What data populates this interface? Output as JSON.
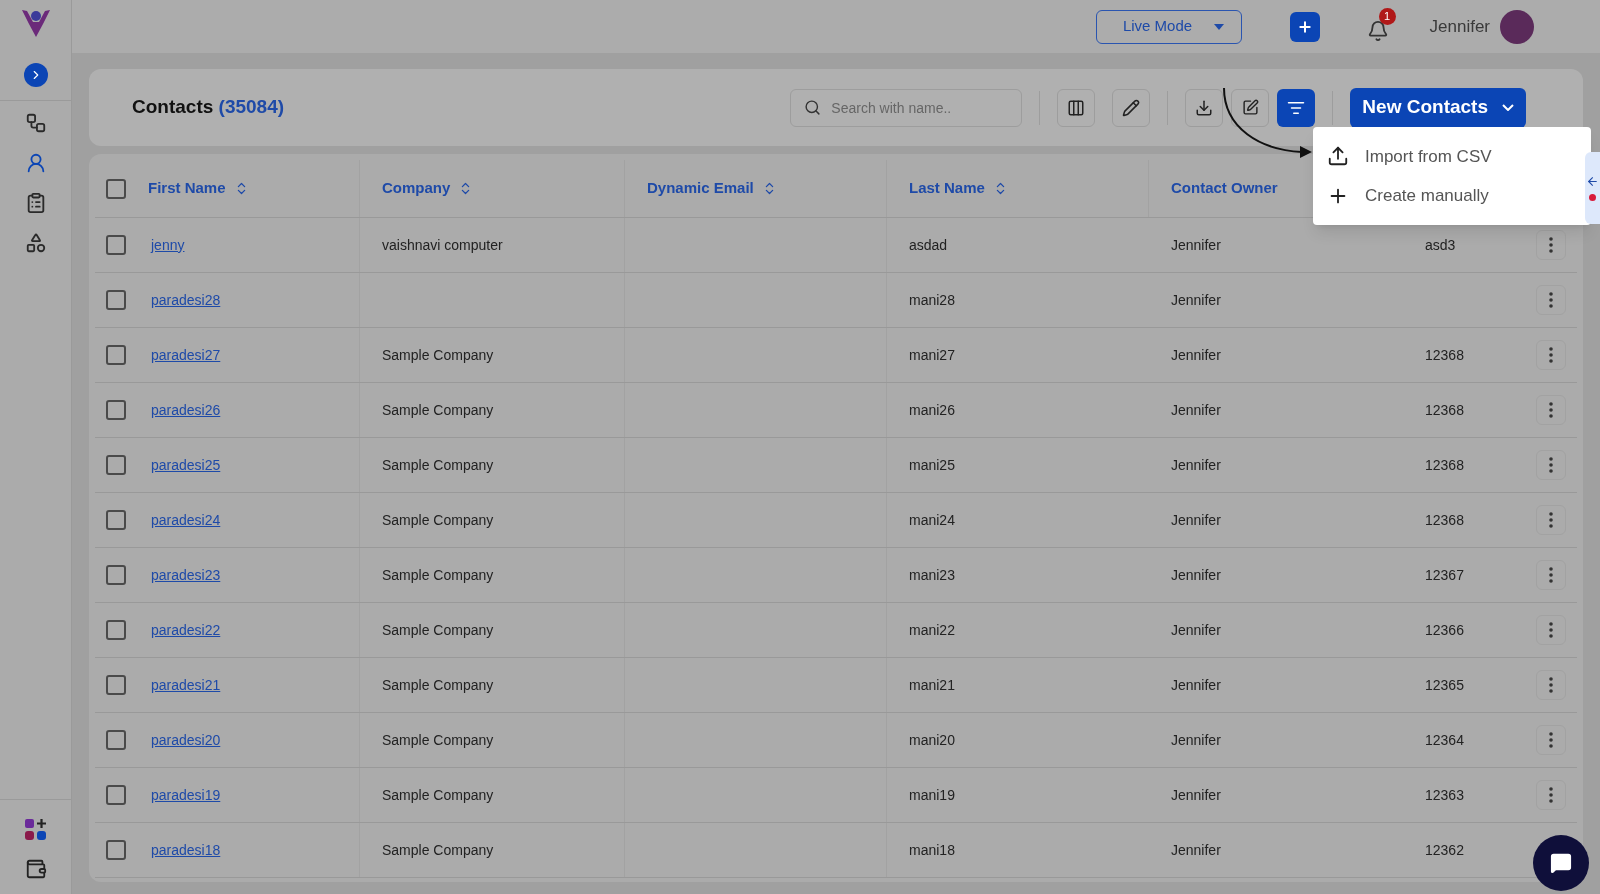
{
  "topbar": {
    "mode_select": "Live Mode",
    "notification_count": "1",
    "user_name": "Jennifer"
  },
  "sidebar": {
    "items": [
      {
        "kind": "flow",
        "selected": false
      },
      {
        "kind": "contacts",
        "selected": true
      },
      {
        "kind": "list",
        "selected": false
      },
      {
        "kind": "shapes",
        "selected": false
      }
    ]
  },
  "header": {
    "title": "Contacts",
    "count": "(35084)",
    "search": {
      "placeholder": "Search with name.."
    },
    "new_button": "New Contacts"
  },
  "menu": {
    "items": [
      {
        "kind": "upload",
        "label": "Import from CSV"
      },
      {
        "kind": "plus",
        "label": "Create manually"
      }
    ]
  },
  "table": {
    "all_checked": false,
    "columns": [
      {
        "label": "First Name",
        "sortable": true
      },
      {
        "label": "Company",
        "sortable": true
      },
      {
        "label": "Dynamic Email",
        "sortable": true
      },
      {
        "label": "Last Name",
        "sortable": true
      },
      {
        "label": "Contact Owner",
        "sortable": false
      }
    ],
    "rows": [
      {
        "checked": false,
        "first_name": "jenny",
        "company": "vaishnavi computer",
        "last_name": "asdad",
        "contact_owner": "Jennifer",
        "column_6": "asd3"
      },
      {
        "checked": false,
        "first_name": "paradesi28",
        "company": "",
        "last_name": "mani28",
        "contact_owner": "Jennifer",
        "column_6": ""
      },
      {
        "checked": false,
        "first_name": "paradesi27",
        "company": "Sample Company",
        "last_name": "mani27",
        "contact_owner": "Jennifer",
        "column_6": "12368"
      },
      {
        "checked": false,
        "first_name": "paradesi26",
        "company": "Sample Company",
        "last_name": "mani26",
        "contact_owner": "Jennifer",
        "column_6": "12368"
      },
      {
        "checked": false,
        "first_name": "paradesi25",
        "company": "Sample Company",
        "last_name": "mani25",
        "contact_owner": "Jennifer",
        "column_6": "12368"
      },
      {
        "checked": false,
        "first_name": "paradesi24",
        "company": "Sample Company",
        "last_name": "mani24",
        "contact_owner": "Jennifer",
        "column_6": "12368"
      },
      {
        "checked": false,
        "first_name": "paradesi23",
        "company": "Sample Company",
        "last_name": "mani23",
        "contact_owner": "Jennifer",
        "column_6": "12367"
      },
      {
        "checked": false,
        "first_name": "paradesi22",
        "company": "Sample Company",
        "last_name": "mani22",
        "contact_owner": "Jennifer",
        "column_6": "12366"
      },
      {
        "checked": false,
        "first_name": "paradesi21",
        "company": "Sample Company",
        "last_name": "mani21",
        "contact_owner": "Jennifer",
        "column_6": "12365"
      },
      {
        "checked": false,
        "first_name": "paradesi20",
        "company": "Sample Company",
        "last_name": "mani20",
        "contact_owner": "Jennifer",
        "column_6": "12364"
      },
      {
        "checked": false,
        "first_name": "paradesi19",
        "company": "Sample Company",
        "last_name": "mani19",
        "contact_owner": "Jennifer",
        "column_6": "12363"
      },
      {
        "checked": false,
        "first_name": "paradesi18",
        "company": "Sample Company",
        "last_name": "mani18",
        "contact_owner": "Jennifer",
        "column_6": "12362"
      }
    ]
  }
}
